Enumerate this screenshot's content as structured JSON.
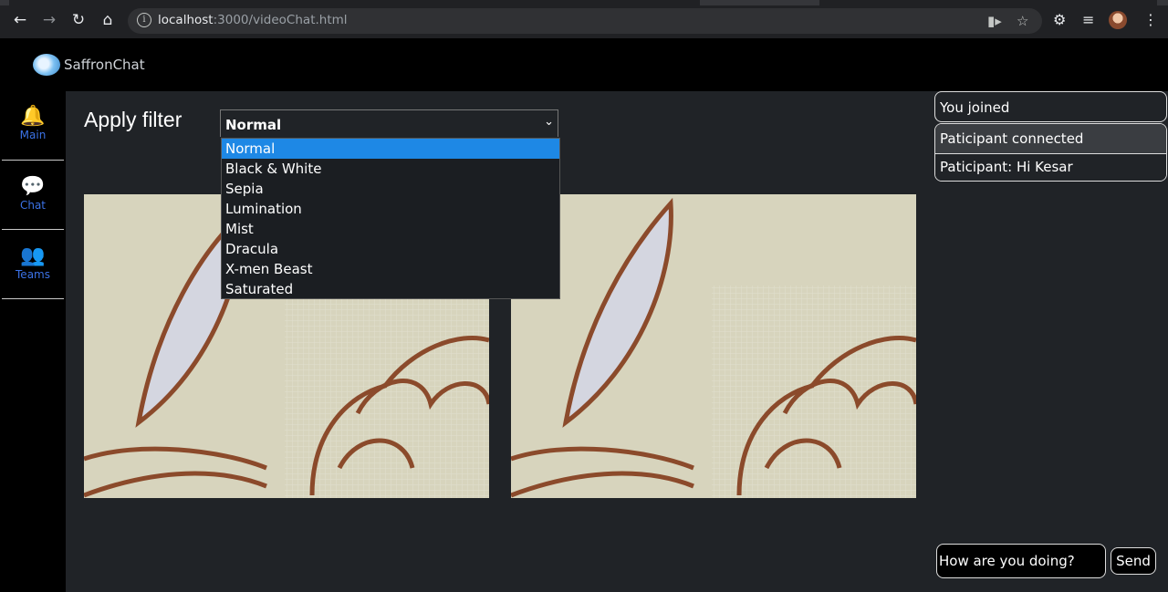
{
  "browser": {
    "url_host": "localhost",
    "url_rest": ":3000/videoChat.html",
    "icons": {
      "back": "arrow-left-icon",
      "forward": "arrow-right-icon",
      "reload": "reload-icon",
      "home": "home-icon",
      "info": "info-icon",
      "camera": "camera-icon",
      "star": "star-icon",
      "extensions": "puzzle-icon",
      "media": "media-icon",
      "menu": "kebab-menu-icon"
    }
  },
  "app": {
    "brand": "SaffronChat"
  },
  "sidebar": {
    "items": [
      {
        "label": "Main",
        "icon": "bell-icon"
      },
      {
        "label": "Chat",
        "icon": "chat-bubbles-icon"
      },
      {
        "label": "Teams",
        "icon": "team-icon"
      }
    ]
  },
  "filter": {
    "label": "Apply filter",
    "selected": "Normal",
    "options": [
      "Normal",
      "Black & White",
      "Sepia",
      "Lumination",
      "Mist",
      "Dracula",
      "X-men Beast",
      "Saturated"
    ]
  },
  "chat": {
    "messages": [
      "You joined",
      "Paticipant connected",
      "Paticipant: Hi Kesar"
    ],
    "input_value": "How are you doing?",
    "send_label": "Send"
  },
  "colors": {
    "main_bg": "#202327",
    "accent_blue": "#1e88e5",
    "sidebar_label": "#3b72e6"
  }
}
